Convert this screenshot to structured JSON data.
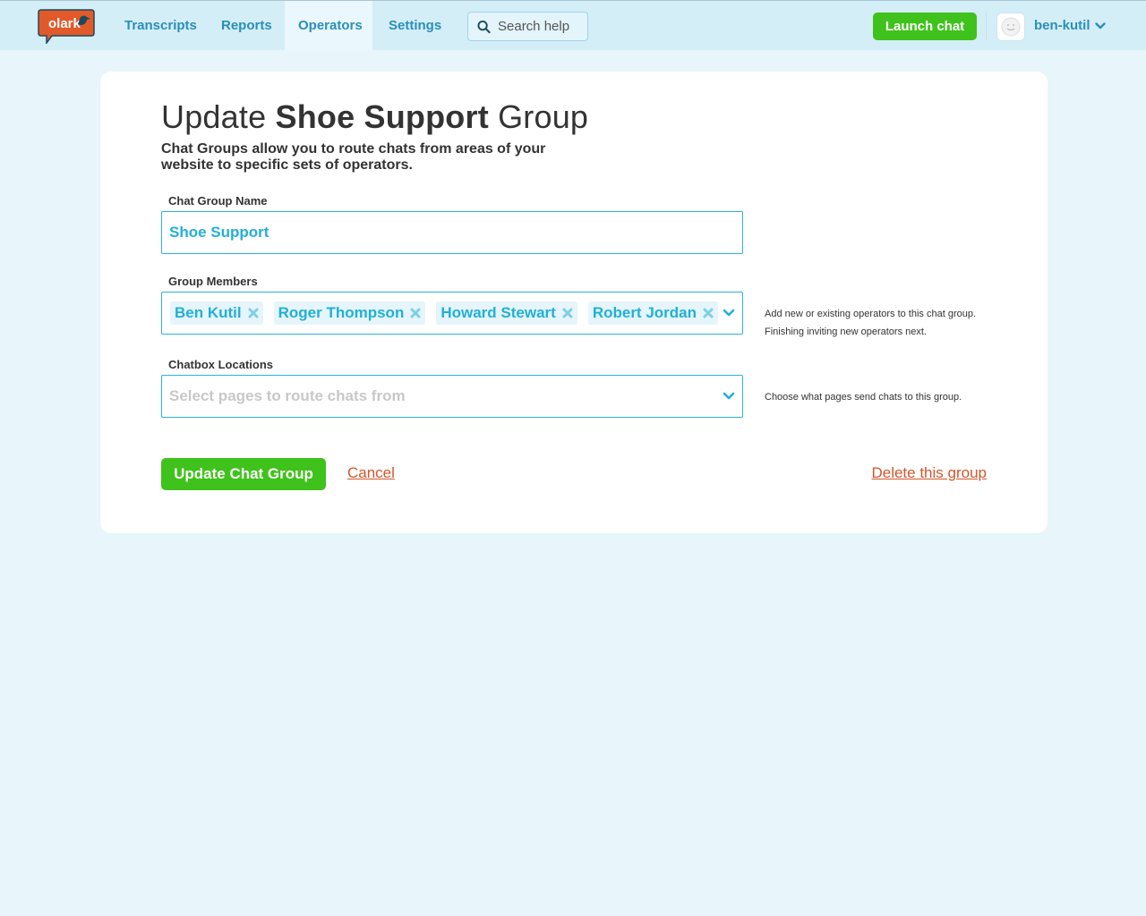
{
  "brand": {
    "logo_text": "olark",
    "logo_color": "#e2592a",
    "accent": "#2a8fb8",
    "green": "#3fc21b"
  },
  "nav": {
    "items": [
      {
        "label": "Transcripts"
      },
      {
        "label": "Reports"
      },
      {
        "label": "Operators",
        "active": true
      },
      {
        "label": "Settings"
      }
    ],
    "search_placeholder": "Search help",
    "launch_label": "Launch chat",
    "username": "ben-kutil"
  },
  "form": {
    "title_prefix": "Update",
    "title_group_name": "Shoe Support",
    "title_suffix": "Group",
    "subtitle": "Chat Groups allow you to route chats from areas of your website to specific sets of operators.",
    "name_label": "Chat Group Name",
    "name_value": "Shoe Support",
    "members_label": "Group Members",
    "members": [
      "Ben Kutil",
      "Roger Thompson",
      "Howard Stewart",
      "Robert Jordan"
    ],
    "members_help_1": "Add new or existing operators to this chat group.",
    "members_help_2": "Finishing inviting new operators next.",
    "locations_label": "Chatbox Locations",
    "locations_placeholder": "Select pages to route chats from",
    "locations_help": "Choose what pages send chats to this group.",
    "submit_label": "Update Chat Group",
    "cancel_label": "Cancel",
    "delete_label": "Delete this group"
  }
}
